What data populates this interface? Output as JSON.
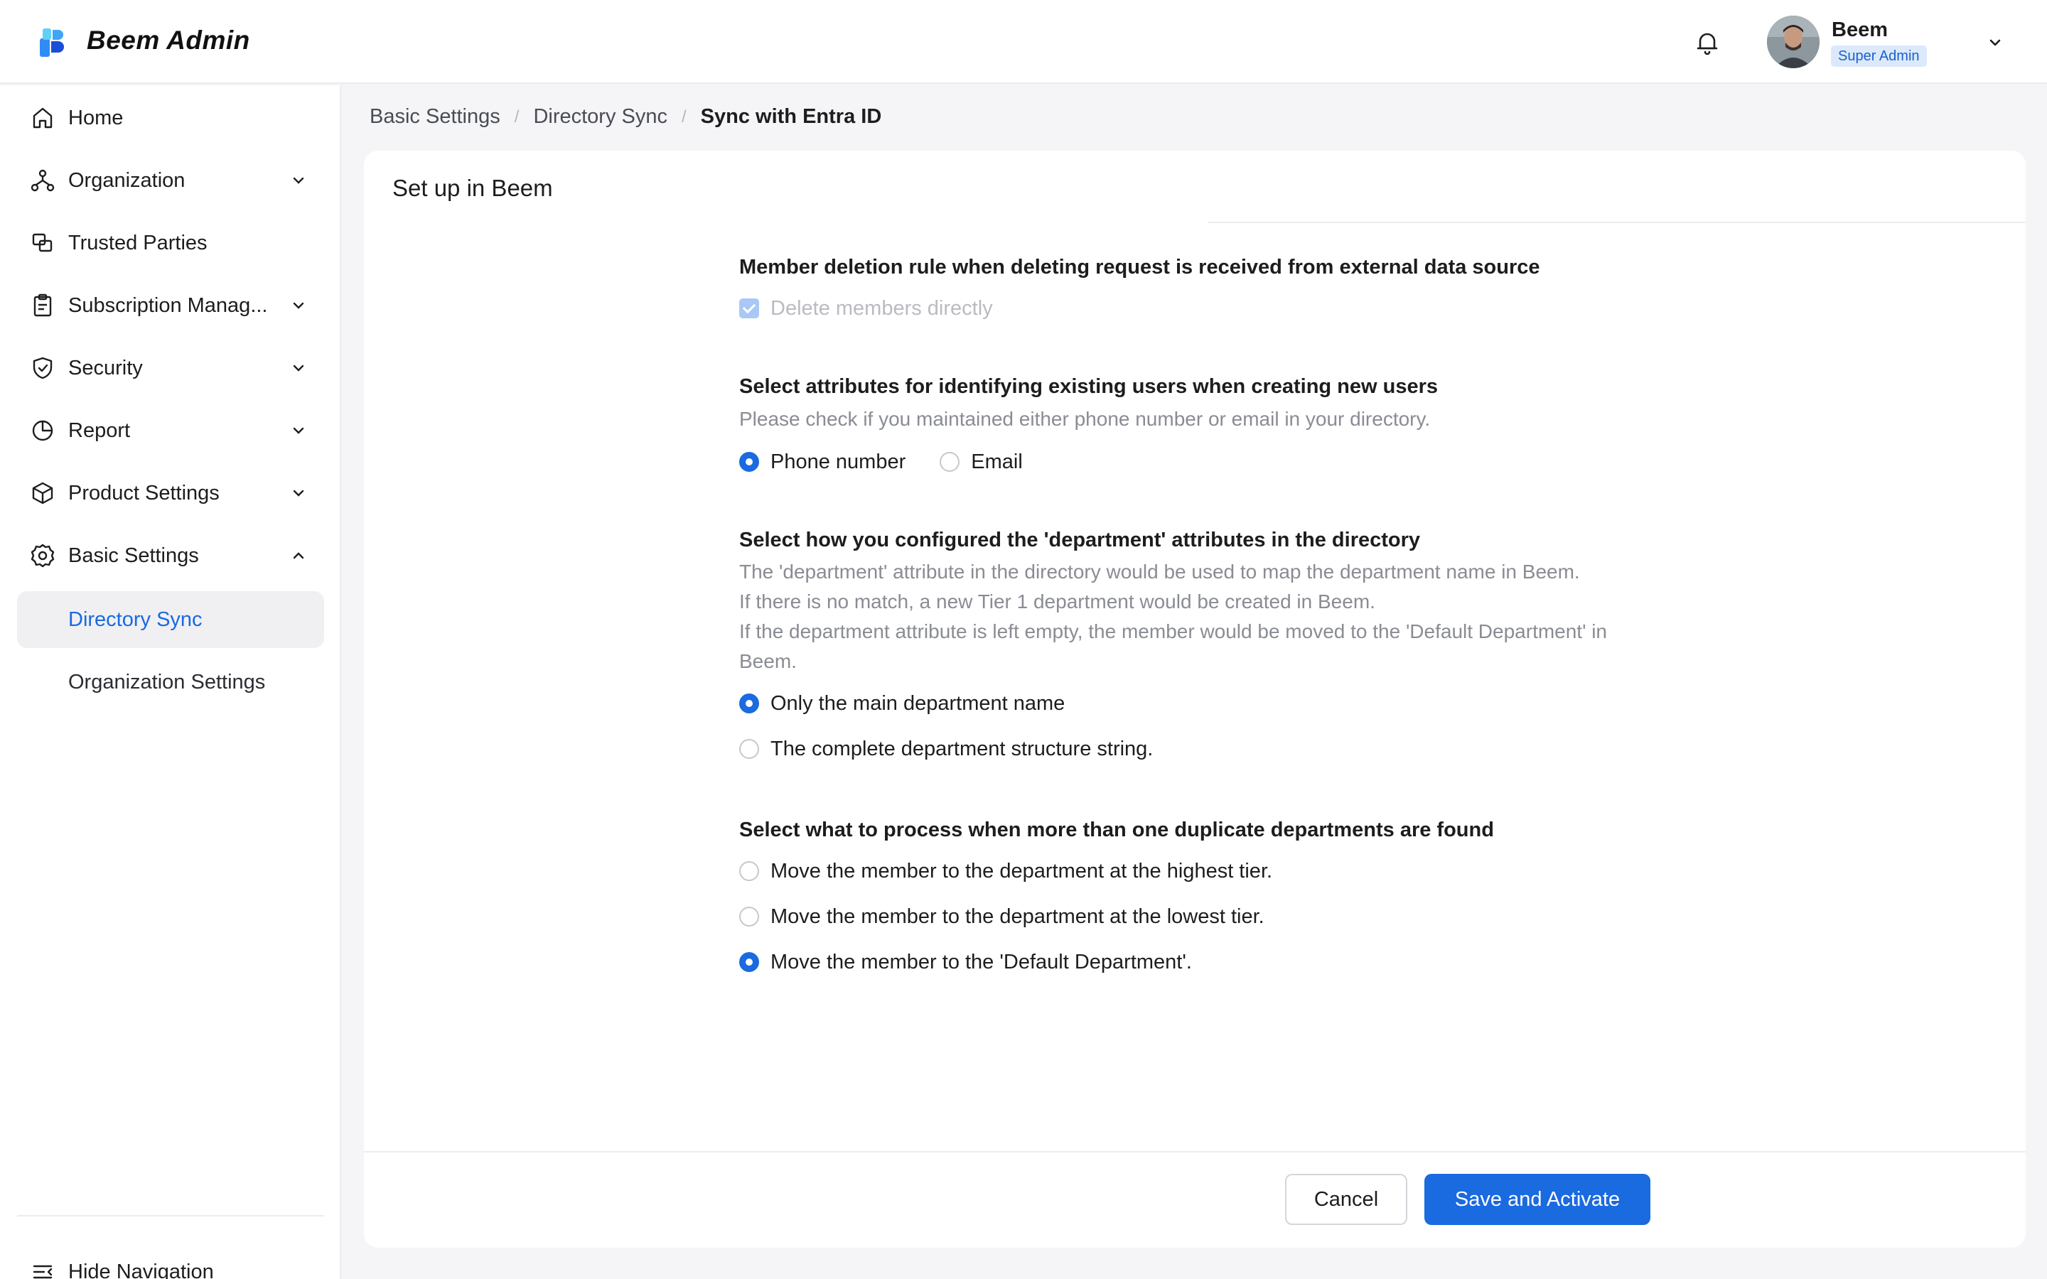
{
  "header": {
    "app_title": "Beem Admin",
    "user_name": "Beem",
    "user_role": "Super Admin"
  },
  "sidebar": {
    "items": [
      {
        "label": "Home",
        "icon": "home-icon"
      },
      {
        "label": "Organization",
        "icon": "organization-icon"
      },
      {
        "label": "Trusted Parties",
        "icon": "trusted-parties-icon"
      },
      {
        "label": "Subscription Manag...",
        "icon": "clipboard-icon"
      },
      {
        "label": "Security",
        "icon": "shield-icon"
      },
      {
        "label": "Report",
        "icon": "pie-chart-icon"
      },
      {
        "label": "Product Settings",
        "icon": "box-icon"
      },
      {
        "label": "Basic Settings",
        "icon": "gear-icon"
      }
    ],
    "sub_items": [
      {
        "label": "Directory Sync",
        "active": true
      },
      {
        "label": "Organization Settings",
        "active": false
      }
    ],
    "hide_nav_label": "Hide Navigation"
  },
  "breadcrumb": {
    "items": [
      "Basic Settings",
      "Directory Sync",
      "Sync with Entra ID"
    ],
    "separator": "/"
  },
  "card": {
    "title": "Set up in Beem"
  },
  "sections": {
    "deletion": {
      "title": "Member deletion rule when deleting request is received from external data source",
      "option": "Delete members directly"
    },
    "attributes": {
      "title": "Select attributes for identifying existing users when creating new users",
      "desc": "Please check if you maintained either phone number or email in your directory.",
      "options": [
        "Phone number",
        "Email"
      ],
      "selected": 0
    },
    "department": {
      "title": "Select how you configured the 'department' attributes in the directory",
      "desc_lines": [
        "The 'department' attribute in the directory would be used to map the department name in Beem.",
        "If there is no match, a new Tier 1 department would be created in Beem.",
        "If the department attribute is left empty, the member would be moved to the 'Default Department' in Beem."
      ],
      "options": [
        "Only the main department name",
        "The complete department structure string."
      ],
      "selected": 0
    },
    "duplicate": {
      "title": "Select what to process when more than one duplicate departments are found",
      "options": [
        "Move the member to the department at the highest tier.",
        "Move the member to the department at the lowest tier.",
        "Move the member to the 'Default Department'."
      ],
      "selected": 2
    }
  },
  "footer": {
    "cancel_label": "Cancel",
    "save_label": "Save and Activate"
  },
  "colors": {
    "accent": "#1a6ae0",
    "badge_bg": "#dbe9fb",
    "active_nav_bg": "#f0f0f3"
  }
}
